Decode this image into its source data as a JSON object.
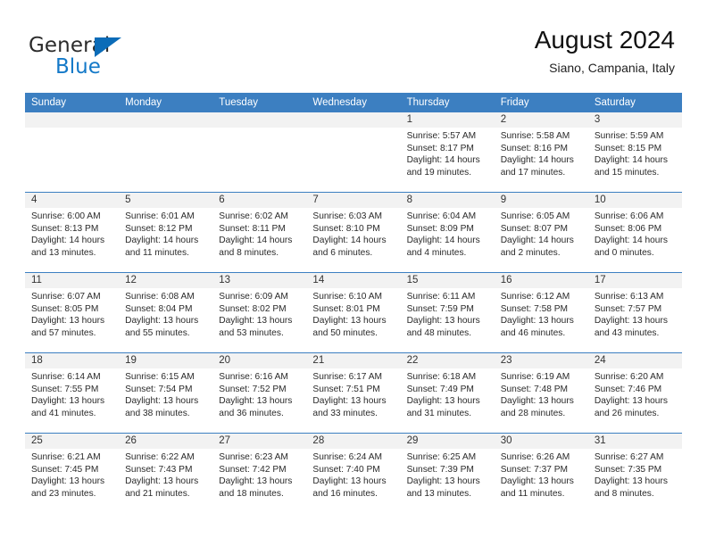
{
  "brand": {
    "name_top": "General",
    "name_bottom": "Blue",
    "accent_color": "#1479c8",
    "triangle_color": "#0b6cb8"
  },
  "header": {
    "title": "August 2024",
    "subtitle": "Siano, Campania, Italy"
  },
  "theme": {
    "header_row_color": "#3c7fc1",
    "date_band_color": "#f2f2f2",
    "text_color": "#2a2a2a"
  },
  "weekdays": [
    "Sunday",
    "Monday",
    "Tuesday",
    "Wednesday",
    "Thursday",
    "Friday",
    "Saturday"
  ],
  "labels": {
    "sunrise": "Sunrise:",
    "sunset": "Sunset:",
    "daylight": "Daylight:"
  },
  "weeks": [
    [
      {
        "day": "",
        "empty": true
      },
      {
        "day": "",
        "empty": true
      },
      {
        "day": "",
        "empty": true
      },
      {
        "day": "",
        "empty": true
      },
      {
        "day": "1",
        "sunrise": "Sunrise: 5:57 AM",
        "sunset": "Sunset: 8:17 PM",
        "daylight_1": "Daylight: 14 hours",
        "daylight_2": "and 19 minutes."
      },
      {
        "day": "2",
        "sunrise": "Sunrise: 5:58 AM",
        "sunset": "Sunset: 8:16 PM",
        "daylight_1": "Daylight: 14 hours",
        "daylight_2": "and 17 minutes."
      },
      {
        "day": "3",
        "sunrise": "Sunrise: 5:59 AM",
        "sunset": "Sunset: 8:15 PM",
        "daylight_1": "Daylight: 14 hours",
        "daylight_2": "and 15 minutes."
      }
    ],
    [
      {
        "day": "4",
        "sunrise": "Sunrise: 6:00 AM",
        "sunset": "Sunset: 8:13 PM",
        "daylight_1": "Daylight: 14 hours",
        "daylight_2": "and 13 minutes."
      },
      {
        "day": "5",
        "sunrise": "Sunrise: 6:01 AM",
        "sunset": "Sunset: 8:12 PM",
        "daylight_1": "Daylight: 14 hours",
        "daylight_2": "and 11 minutes."
      },
      {
        "day": "6",
        "sunrise": "Sunrise: 6:02 AM",
        "sunset": "Sunset: 8:11 PM",
        "daylight_1": "Daylight: 14 hours",
        "daylight_2": "and 8 minutes."
      },
      {
        "day": "7",
        "sunrise": "Sunrise: 6:03 AM",
        "sunset": "Sunset: 8:10 PM",
        "daylight_1": "Daylight: 14 hours",
        "daylight_2": "and 6 minutes."
      },
      {
        "day": "8",
        "sunrise": "Sunrise: 6:04 AM",
        "sunset": "Sunset: 8:09 PM",
        "daylight_1": "Daylight: 14 hours",
        "daylight_2": "and 4 minutes."
      },
      {
        "day": "9",
        "sunrise": "Sunrise: 6:05 AM",
        "sunset": "Sunset: 8:07 PM",
        "daylight_1": "Daylight: 14 hours",
        "daylight_2": "and 2 minutes."
      },
      {
        "day": "10",
        "sunrise": "Sunrise: 6:06 AM",
        "sunset": "Sunset: 8:06 PM",
        "daylight_1": "Daylight: 14 hours",
        "daylight_2": "and 0 minutes."
      }
    ],
    [
      {
        "day": "11",
        "sunrise": "Sunrise: 6:07 AM",
        "sunset": "Sunset: 8:05 PM",
        "daylight_1": "Daylight: 13 hours",
        "daylight_2": "and 57 minutes."
      },
      {
        "day": "12",
        "sunrise": "Sunrise: 6:08 AM",
        "sunset": "Sunset: 8:04 PM",
        "daylight_1": "Daylight: 13 hours",
        "daylight_2": "and 55 minutes."
      },
      {
        "day": "13",
        "sunrise": "Sunrise: 6:09 AM",
        "sunset": "Sunset: 8:02 PM",
        "daylight_1": "Daylight: 13 hours",
        "daylight_2": "and 53 minutes."
      },
      {
        "day": "14",
        "sunrise": "Sunrise: 6:10 AM",
        "sunset": "Sunset: 8:01 PM",
        "daylight_1": "Daylight: 13 hours",
        "daylight_2": "and 50 minutes."
      },
      {
        "day": "15",
        "sunrise": "Sunrise: 6:11 AM",
        "sunset": "Sunset: 7:59 PM",
        "daylight_1": "Daylight: 13 hours",
        "daylight_2": "and 48 minutes."
      },
      {
        "day": "16",
        "sunrise": "Sunrise: 6:12 AM",
        "sunset": "Sunset: 7:58 PM",
        "daylight_1": "Daylight: 13 hours",
        "daylight_2": "and 46 minutes."
      },
      {
        "day": "17",
        "sunrise": "Sunrise: 6:13 AM",
        "sunset": "Sunset: 7:57 PM",
        "daylight_1": "Daylight: 13 hours",
        "daylight_2": "and 43 minutes."
      }
    ],
    [
      {
        "day": "18",
        "sunrise": "Sunrise: 6:14 AM",
        "sunset": "Sunset: 7:55 PM",
        "daylight_1": "Daylight: 13 hours",
        "daylight_2": "and 41 minutes."
      },
      {
        "day": "19",
        "sunrise": "Sunrise: 6:15 AM",
        "sunset": "Sunset: 7:54 PM",
        "daylight_1": "Daylight: 13 hours",
        "daylight_2": "and 38 minutes."
      },
      {
        "day": "20",
        "sunrise": "Sunrise: 6:16 AM",
        "sunset": "Sunset: 7:52 PM",
        "daylight_1": "Daylight: 13 hours",
        "daylight_2": "and 36 minutes."
      },
      {
        "day": "21",
        "sunrise": "Sunrise: 6:17 AM",
        "sunset": "Sunset: 7:51 PM",
        "daylight_1": "Daylight: 13 hours",
        "daylight_2": "and 33 minutes."
      },
      {
        "day": "22",
        "sunrise": "Sunrise: 6:18 AM",
        "sunset": "Sunset: 7:49 PM",
        "daylight_1": "Daylight: 13 hours",
        "daylight_2": "and 31 minutes."
      },
      {
        "day": "23",
        "sunrise": "Sunrise: 6:19 AM",
        "sunset": "Sunset: 7:48 PM",
        "daylight_1": "Daylight: 13 hours",
        "daylight_2": "and 28 minutes."
      },
      {
        "day": "24",
        "sunrise": "Sunrise: 6:20 AM",
        "sunset": "Sunset: 7:46 PM",
        "daylight_1": "Daylight: 13 hours",
        "daylight_2": "and 26 minutes."
      }
    ],
    [
      {
        "day": "25",
        "sunrise": "Sunrise: 6:21 AM",
        "sunset": "Sunset: 7:45 PM",
        "daylight_1": "Daylight: 13 hours",
        "daylight_2": "and 23 minutes."
      },
      {
        "day": "26",
        "sunrise": "Sunrise: 6:22 AM",
        "sunset": "Sunset: 7:43 PM",
        "daylight_1": "Daylight: 13 hours",
        "daylight_2": "and 21 minutes."
      },
      {
        "day": "27",
        "sunrise": "Sunrise: 6:23 AM",
        "sunset": "Sunset: 7:42 PM",
        "daylight_1": "Daylight: 13 hours",
        "daylight_2": "and 18 minutes."
      },
      {
        "day": "28",
        "sunrise": "Sunrise: 6:24 AM",
        "sunset": "Sunset: 7:40 PM",
        "daylight_1": "Daylight: 13 hours",
        "daylight_2": "and 16 minutes."
      },
      {
        "day": "29",
        "sunrise": "Sunrise: 6:25 AM",
        "sunset": "Sunset: 7:39 PM",
        "daylight_1": "Daylight: 13 hours",
        "daylight_2": "and 13 minutes."
      },
      {
        "day": "30",
        "sunrise": "Sunrise: 6:26 AM",
        "sunset": "Sunset: 7:37 PM",
        "daylight_1": "Daylight: 13 hours",
        "daylight_2": "and 11 minutes."
      },
      {
        "day": "31",
        "sunrise": "Sunrise: 6:27 AM",
        "sunset": "Sunset: 7:35 PM",
        "daylight_1": "Daylight: 13 hours",
        "daylight_2": "and 8 minutes."
      }
    ]
  ]
}
